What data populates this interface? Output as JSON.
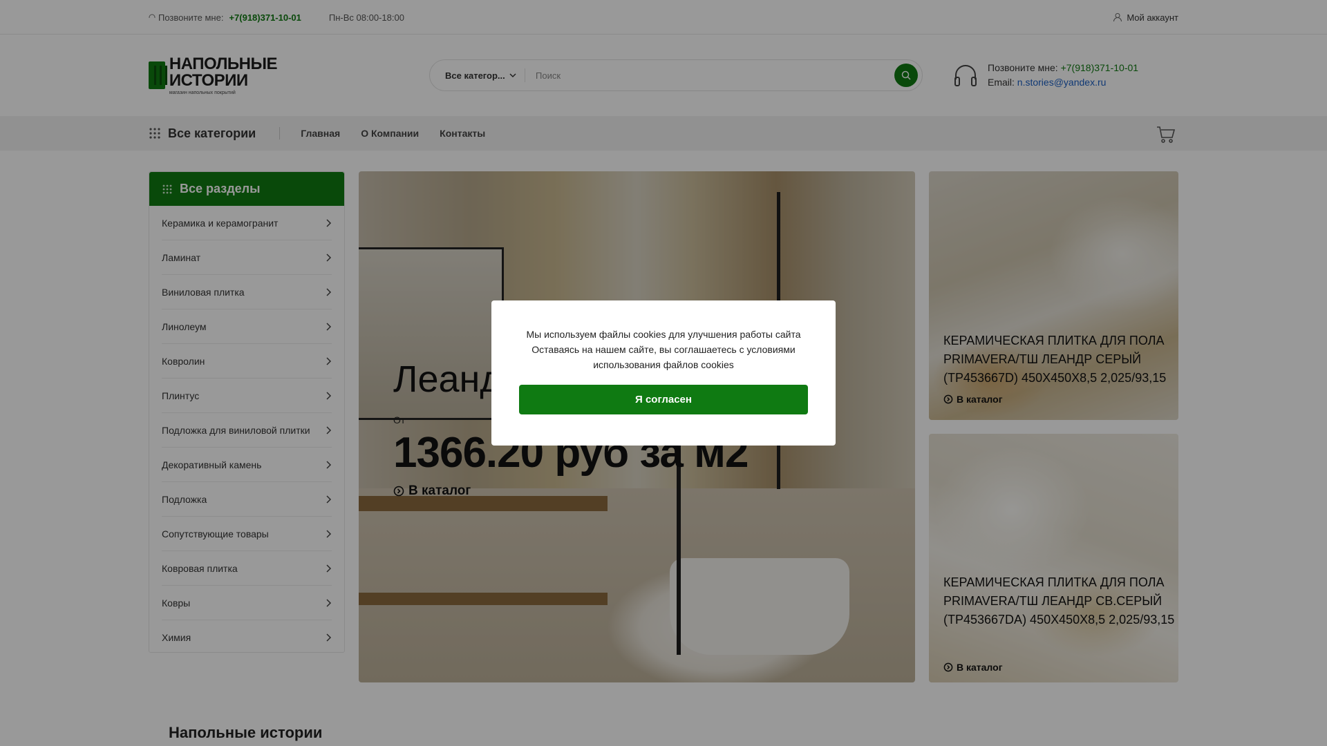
{
  "topbar": {
    "call_label": "Позвоните мне:",
    "phone": "+7(918)371-10-01",
    "hours": "Пн-Вс 08:00-18:00",
    "account": "Мой аккаунт"
  },
  "logo": {
    "line1": "НАПОЛЬНЫЕ",
    "line2": "ИСТОРИИ",
    "tagline": "магазин напольных покрытий"
  },
  "search": {
    "category": "Все категор...",
    "placeholder": "Поиск"
  },
  "contact": {
    "call_label": "Позвоните мне:",
    "phone": "+7(918)371-10-01",
    "email_label": "Email:",
    "email": "n.stories@yandex.ru"
  },
  "nav": {
    "all_categories": "Все категории",
    "links": [
      "Главная",
      "О Компании",
      "Контакты"
    ]
  },
  "sidebar": {
    "title": "Все разделы",
    "items": [
      "Керамика и керамогранит",
      "Ламинат",
      "Виниловая плитка",
      "Линолеум",
      "Ковролин",
      "Плинтус",
      "Подложка для виниловой плитки",
      "Декоративный камень",
      "Подложка",
      "Сопутствующие товары",
      "Ковровая плитка",
      "Ковры",
      "Химия"
    ]
  },
  "banner": {
    "title": "Леандр",
    "from": "От",
    "price": "1366.20 руб за м2",
    "link": "В каталог"
  },
  "cards": [
    {
      "title": "КЕРАМИЧЕСКАЯ ПЛИТКА ДЛЯ ПОЛА PRIMAVERA/ТШ ЛЕАНДР СЕРЫЙ (TP453667D) 450X450X8,5 2,025/93,15",
      "link": "В каталог"
    },
    {
      "title": "КЕРАМИЧЕСКАЯ ПЛИТКА ДЛЯ ПОЛА PRIMAVERA/ТШ ЛЕАНДР СВ.СЕРЫЙ (TP453667DA) 450X450X8,5 2,025/93,15",
      "link": "В каталог"
    }
  ],
  "section": {
    "title": "Напольные истории"
  },
  "cookie": {
    "line1": "Мы используем файлы cookies для улучшения работы сайта",
    "line2": "Оставаясь на нашем сайте, вы соглашаетесь с условиями",
    "line3": "использования файлов cookies",
    "accept": "Я согласен"
  },
  "colors": {
    "accent": "#0f7a12",
    "link_blue": "#1b5fc4"
  }
}
